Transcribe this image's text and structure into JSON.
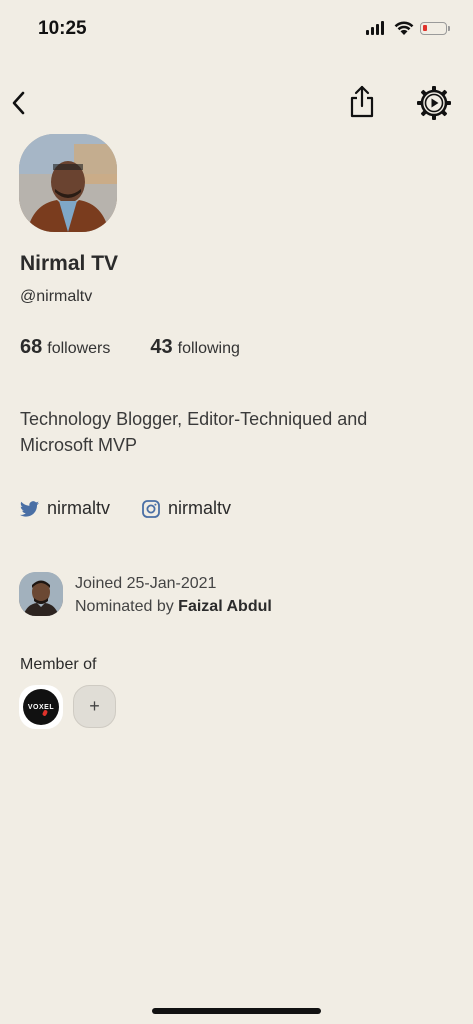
{
  "status_bar": {
    "time": "10:25"
  },
  "profile": {
    "name": "Nirmal TV",
    "handle": "@nirmaltv",
    "followers_count": "68",
    "followers_label": "followers",
    "following_count": "43",
    "following_label": "following",
    "bio": "Technology Blogger, Editor-Techniqued and Microsoft MVP"
  },
  "social": {
    "twitter": "nirmaltv",
    "instagram": "nirmaltv"
  },
  "joined": {
    "date_text": "Joined 25-Jan-2021",
    "nominated_prefix": "Nominated by ",
    "nominated_by": "Faizal Abdul"
  },
  "clubs": {
    "label": "Member of",
    "club_badge_text": "VOXEL",
    "add_symbol": "+"
  },
  "colors": {
    "background": "#f1ede4",
    "text": "#2b2b2b",
    "twitter": "#4a6fa5",
    "battery_low": "#e0322b"
  }
}
